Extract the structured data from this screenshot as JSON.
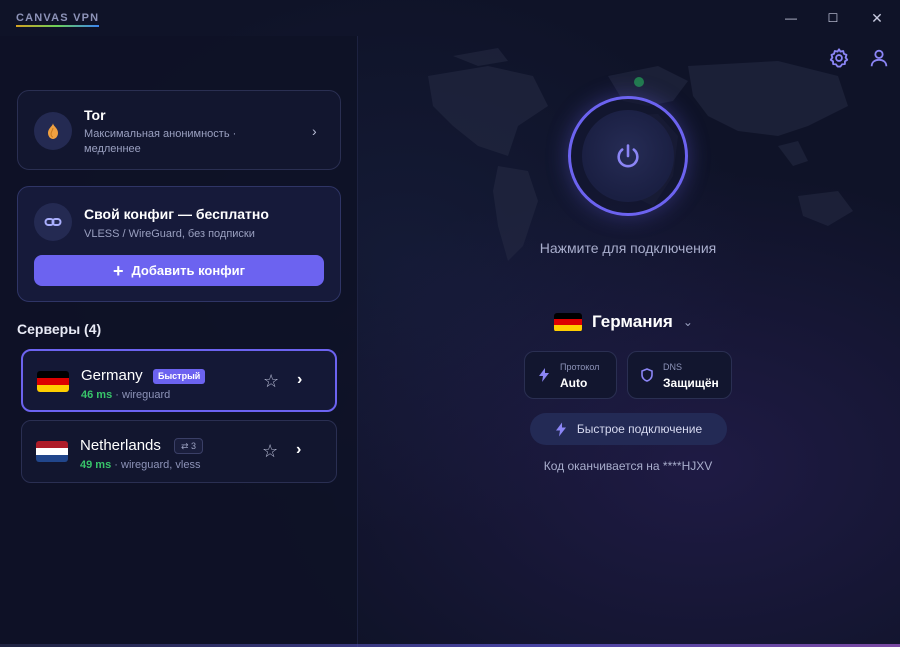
{
  "window": {
    "title": "CANVAS VPN",
    "controls": {
      "minimize": "—",
      "maximize": "☐",
      "close": "✕"
    }
  },
  "tor_card": {
    "title": "Tor",
    "subtitle": "Максимальная анонимность · медленнее",
    "icon": "onion-icon"
  },
  "config_card": {
    "title": "Свой конфиг — бесплатно",
    "subtitle": "VLESS / WireGuard, без подписки",
    "icon": "link-icon",
    "button_label": "Добавить конфиг"
  },
  "servers": {
    "header": "Серверы (4)",
    "items": [
      {
        "name": "Germany",
        "badge": "Быстрый",
        "ping": "46 ms",
        "protocols": "wireguard",
        "selected": true,
        "flag_colors": [
          "#000000",
          "#dd0000",
          "#ffce00"
        ]
      },
      {
        "name": "Netherlands",
        "badge": "⇄ 3",
        "ping": "49 ms",
        "protocols": "wireguard, vless",
        "selected": false,
        "flag_colors": [
          "#ae1c28",
          "#ffffff",
          "#21468b"
        ]
      }
    ]
  },
  "main": {
    "connect_hint": "Нажмите для подключения",
    "country": "Германия",
    "protocol": {
      "label": "Протокол",
      "value": "Auto"
    },
    "dns": {
      "label": "DNS",
      "value": "Защищён"
    },
    "quick_connect_label": "Быстрое подключение",
    "code_line": "Код оканчивается на ****HJXV"
  },
  "colors": {
    "accent": "#6c63f0",
    "ping_good": "#38c46a",
    "background": "#0f1328",
    "map_marker": "#2fd06a"
  }
}
